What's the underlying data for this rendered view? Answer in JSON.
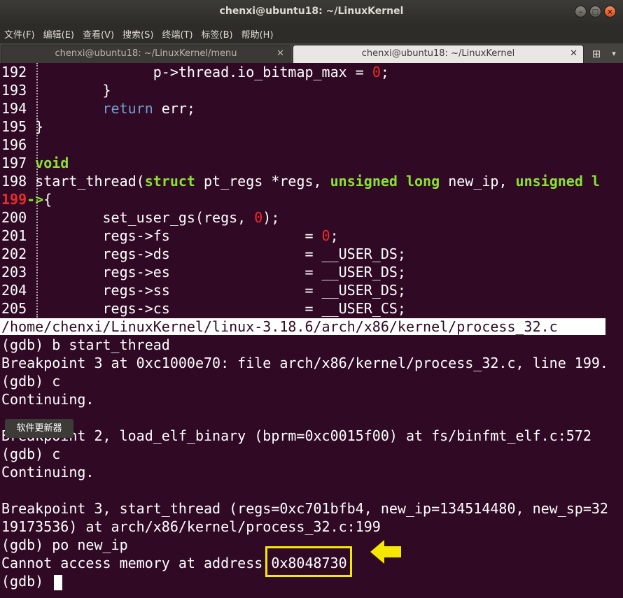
{
  "window": {
    "title": "chenxi@ubuntu18: ~/LinuxKernel",
    "buttons": [
      "minimize",
      "maximize",
      "close"
    ]
  },
  "menu": [
    "文件(F)",
    "编辑(E)",
    "查看(V)",
    "搜索(S)",
    "终端(T)",
    "标签(B)",
    "帮助(H)"
  ],
  "tabs": [
    {
      "label": "chenxi@ubuntu18: ~/LinuxKernel/menu",
      "active": false
    },
    {
      "label": "chenxi@ubuntu18: ~/LinuxKernel",
      "active": true
    }
  ],
  "source": {
    "lines": [
      {
        "num": "192",
        "code": "              p->thread.io_bitmap_max = 0;"
      },
      {
        "num": "193",
        "code": "        }"
      },
      {
        "num": "194",
        "code": "        return err;"
      },
      {
        "num": "195",
        "code": "}"
      },
      {
        "num": "196",
        "code": ""
      },
      {
        "num": "197",
        "code": "void"
      },
      {
        "num": "198",
        "code": "start_thread(struct pt_regs *regs, unsigned long new_ip, unsigned l"
      },
      {
        "num": "199",
        "code": "{",
        "current": true,
        "marker": "->"
      },
      {
        "num": "200",
        "code": "        set_user_gs(regs, 0);"
      },
      {
        "num": "201",
        "code": "        regs->fs                = 0;"
      },
      {
        "num": "202",
        "code": "        regs->ds                = __USER_DS;"
      },
      {
        "num": "203",
        "code": "        regs->es                = __USER_DS;"
      },
      {
        "num": "204",
        "code": "        regs->ss                = __USER_DS;"
      },
      {
        "num": "205",
        "code": "        regs->cs                = __USER_CS;"
      }
    ],
    "file_path": "/home/chenxi/LinuxKernel/linux-3.18.6/arch/x86/kernel/process_32.c"
  },
  "console": [
    "(gdb) b start_thread",
    "Breakpoint 3 at 0xc1000e70: file arch/x86/kernel/process_32.c, line 199.",
    "(gdb) c",
    "Continuing.",
    "",
    "Breakpoint 2, load_elf_binary (bprm=0xc0015f00) at fs/binfmt_elf.c:572",
    "(gdb) c",
    "Continuing.",
    "",
    "Breakpoint 3, start_thread (regs=0xc701bfb4, new_ip=134514480, new_sp=32",
    "19173536) at arch/x86/kernel/process_32.c:199",
    "(gdb) po new_ip",
    "Cannot access memory at address 0x8048730",
    "(gdb) "
  ],
  "tooltip": "软件更新器",
  "highlight": {
    "text": "0x8048730",
    "color": "#f5e800"
  },
  "colors": {
    "background": "#300a24",
    "keyword": "#729fcf",
    "type": "#8ae234",
    "literal": "#ef2929"
  }
}
